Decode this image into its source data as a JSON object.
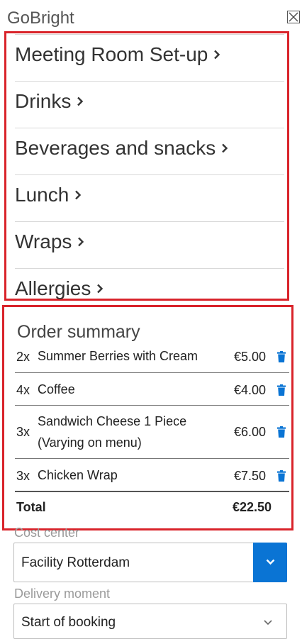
{
  "app": {
    "title": "GoBright"
  },
  "menu": {
    "items": [
      {
        "label": "Meeting Room Set-up"
      },
      {
        "label": "Drinks"
      },
      {
        "label": "Beverages and snacks"
      },
      {
        "label": "Lunch"
      },
      {
        "label": "Wraps"
      },
      {
        "label": "Allergies"
      }
    ]
  },
  "order_summary": {
    "title": "Order summary",
    "items": [
      {
        "qty": "2x",
        "name": "Summer Berries with Cream",
        "price": "€5.00"
      },
      {
        "qty": "4x",
        "name": "Coffee",
        "price": "€4.00"
      },
      {
        "qty": "3x",
        "name": "Sandwich Cheese 1 Piece (Varying on menu)",
        "price": "€6.00"
      },
      {
        "qty": "3x",
        "name": "Chicken Wrap",
        "price": "€7.50"
      }
    ],
    "total_label": "Total",
    "total_value": "€22.50"
  },
  "cost_center": {
    "label": "Cost center",
    "value": "Facility Rotterdam"
  },
  "delivery": {
    "label": "Delivery moment",
    "value": "Start of booking"
  },
  "colors": {
    "highlight": "#d9232a",
    "accent": "#0a74d4"
  },
  "icons": {
    "close": "close-icon",
    "chevron": "chevron-right-icon",
    "trash": "trash-icon",
    "dropdown": "chevron-down-icon"
  }
}
